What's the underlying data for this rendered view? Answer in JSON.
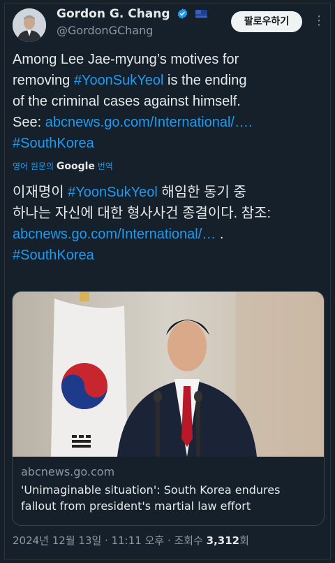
{
  "author": {
    "name": "Gordon G. Chang",
    "handle": "@GordonGChang"
  },
  "header": {
    "follow_label": "팔로우하기",
    "more_symbol": "⋮"
  },
  "tweet": {
    "text_line1": "Among Lee Jae-myung’s motives for",
    "text_line2_a": "removing ",
    "hashtag1": "#YoonSukYeol",
    "text_line2_b": " is the ending",
    "text_line3": "of the criminal cases against himself.",
    "text_line4_a": "See: ",
    "link": "abcnews.go.com/International/…",
    "text_line4_b": ".",
    "hashtag2": "#SouthKorea"
  },
  "translation": {
    "prefix": "영어 원문의 ",
    "brand": "Google",
    "suffix": " 번역",
    "line1_a": "이재명이 ",
    "hashtag1": "#YoonSukYeol",
    "line1_b": " 해임한 동기 중",
    "line2": "하나는 자신에 대한 형사사건 종결이다. 참조:",
    "link": "abcnews.go.com/International/…",
    "link_suffix": " .",
    "hashtag2": "#SouthKorea"
  },
  "card": {
    "domain": "abcnews.go.com",
    "title": "'Unimaginable situation': South Korea endures fallout from president's martial law effort"
  },
  "meta": {
    "date": "2024년 12월 13일 · 11:11 오후 · 조회수 ",
    "views": "3,312",
    "views_suffix": "회"
  },
  "colors": {
    "background": "#15202b",
    "link": "#1d9bf0",
    "verified": "#1d9bf0",
    "muted": "#8b98a5"
  }
}
